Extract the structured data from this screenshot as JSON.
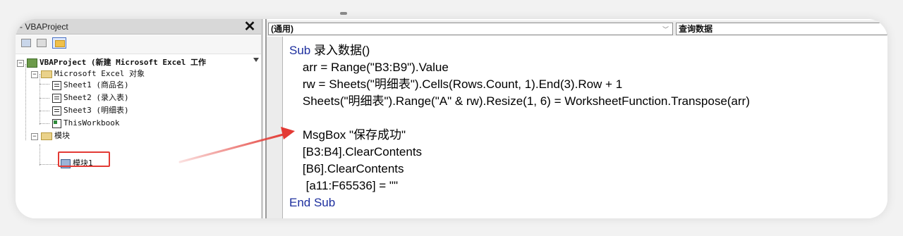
{
  "explorer": {
    "title": "- VBAProject",
    "close_label": "✕",
    "tree": {
      "root": "VBAProject (新建 Microsoft Excel 工作",
      "group_objects": "Microsoft Excel 对象",
      "sheets": [
        "Sheet1 (商品名)",
        "Sheet2 (录入表)",
        "Sheet3 (明细表)"
      ],
      "workbook": "ThisWorkbook",
      "group_modules": "模块",
      "module": "模块1"
    }
  },
  "code": {
    "object_combo": "(通用)",
    "proc_combo": "查询数据",
    "lines": [
      {
        "kw": "Sub ",
        "text": "录入数据()"
      },
      {
        "kw": "",
        "text": "    arr = Range(\"B3:B9\").Value"
      },
      {
        "kw": "",
        "text": "    rw = Sheets(\"明细表\").Cells(Rows.Count, 1).End(3).Row + 1"
      },
      {
        "kw": "",
        "text": "    Sheets(\"明细表\").Range(\"A\" & rw).Resize(1, 6) = WorksheetFunction.Transpose(arr)"
      },
      {
        "kw": "",
        "text": ""
      },
      {
        "kw": "",
        "text": "    MsgBox \"保存成功\""
      },
      {
        "kw": "",
        "text": "    [B3:B4].ClearContents"
      },
      {
        "kw": "",
        "text": "    [B6].ClearContents"
      },
      {
        "kw": "",
        "text": "     [a11:F65536] = \"\""
      },
      {
        "kw": "End Sub",
        "text": ""
      }
    ]
  },
  "colors": {
    "keyword": "#1d2f9e",
    "highlight": "#e33a34"
  }
}
